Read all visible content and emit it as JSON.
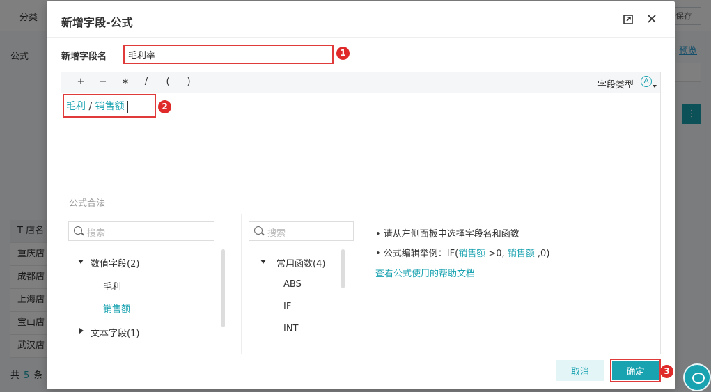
{
  "background": {
    "category_label": "分类",
    "save_label": "保存",
    "formula_label": "公式",
    "preview_link": "预览",
    "table_header": "店名",
    "table_rows": [
      "重庆店",
      "成都店",
      "上海店",
      "宝山店",
      "武汉店"
    ],
    "total_prefix": "共",
    "total_count": "5",
    "total_suffix": "条"
  },
  "dialog": {
    "title": "新增字段-公式",
    "field_name_label": "新增字段名",
    "field_name_value": "毛利率",
    "operators": [
      "+",
      "−",
      "∗",
      "/",
      "(",
      ")"
    ],
    "field_type_label": "字段类型",
    "field_type_icon": "A",
    "formula": {
      "field1": "毛利",
      "operator": " / ",
      "field2": "销售额"
    },
    "validity_text": "公式合法",
    "fields_panel": {
      "search_placeholder": "搜索",
      "numeric_group": "数值字段(2)",
      "numeric_items": [
        "毛利",
        "销售额"
      ],
      "text_group": "文本字段(1)"
    },
    "functions_panel": {
      "search_placeholder": "搜索",
      "group": "常用函数(4)",
      "items": [
        "ABS",
        "IF",
        "INT"
      ]
    },
    "help": {
      "line1": "• 请从左侧面板中选择字段名和函数",
      "line2_prefix": "• 公式编辑举例：IF(",
      "line2_field1": "销售额",
      "line2_mid": " >0, ",
      "line2_field2": "销售额",
      "line2_suffix": " ,0)",
      "link": "查看公式使用的帮助文档"
    },
    "cancel_label": "取消",
    "ok_label": "确定"
  },
  "annotations": [
    "1",
    "2",
    "3"
  ],
  "colors": {
    "accent": "#19a2b0",
    "highlight_box": "#e03a3a"
  }
}
